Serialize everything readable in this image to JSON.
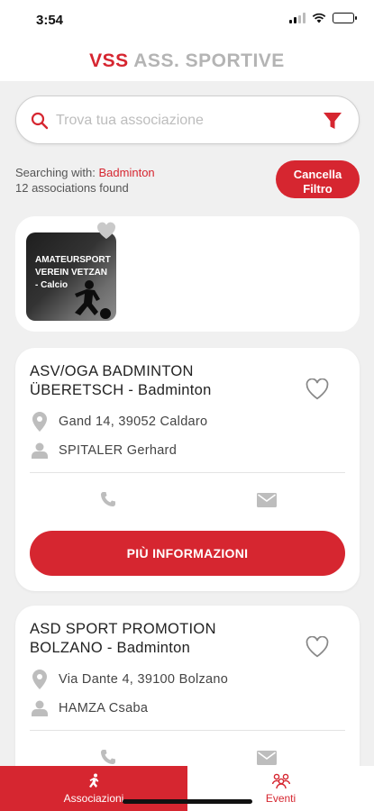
{
  "status": {
    "time": "3:54"
  },
  "header": {
    "brand": "VSS",
    "subtitle": "ASS. SPORTIVE"
  },
  "search": {
    "placeholder": "Trova tua associazione"
  },
  "search_info": {
    "prefix": "Searching with:",
    "term": "Badminton",
    "count_text": "12 associations found",
    "cancel_label_line1": "Cancella",
    "cancel_label_line2": "Filtro"
  },
  "featured": {
    "label": "AMATEURSPORTVEREIN VETZAN - Calcio"
  },
  "cards": [
    {
      "title": "ASV/OGA BADMINTON ÜBERETSCH - Badminton",
      "address": "Gand 14, 39052  Caldaro",
      "contact": "SPITALER Gerhard",
      "button": "PIÙ INFORMAZIONI"
    },
    {
      "title": "ASD SPORT PROMOTION BOLZANO - Badminton",
      "address": "Via Dante 4, 39100  Bolzano",
      "contact": "HAMZA Csaba"
    }
  ],
  "tabs": [
    {
      "label": "Associazioni",
      "icon": "runner-icon",
      "active": true
    },
    {
      "label": "Eventi",
      "icon": "people-icon",
      "active": false
    }
  ],
  "colors": {
    "accent": "#d62630",
    "muted": "#b4b4b4",
    "icon_gray": "#bdbdbd"
  }
}
